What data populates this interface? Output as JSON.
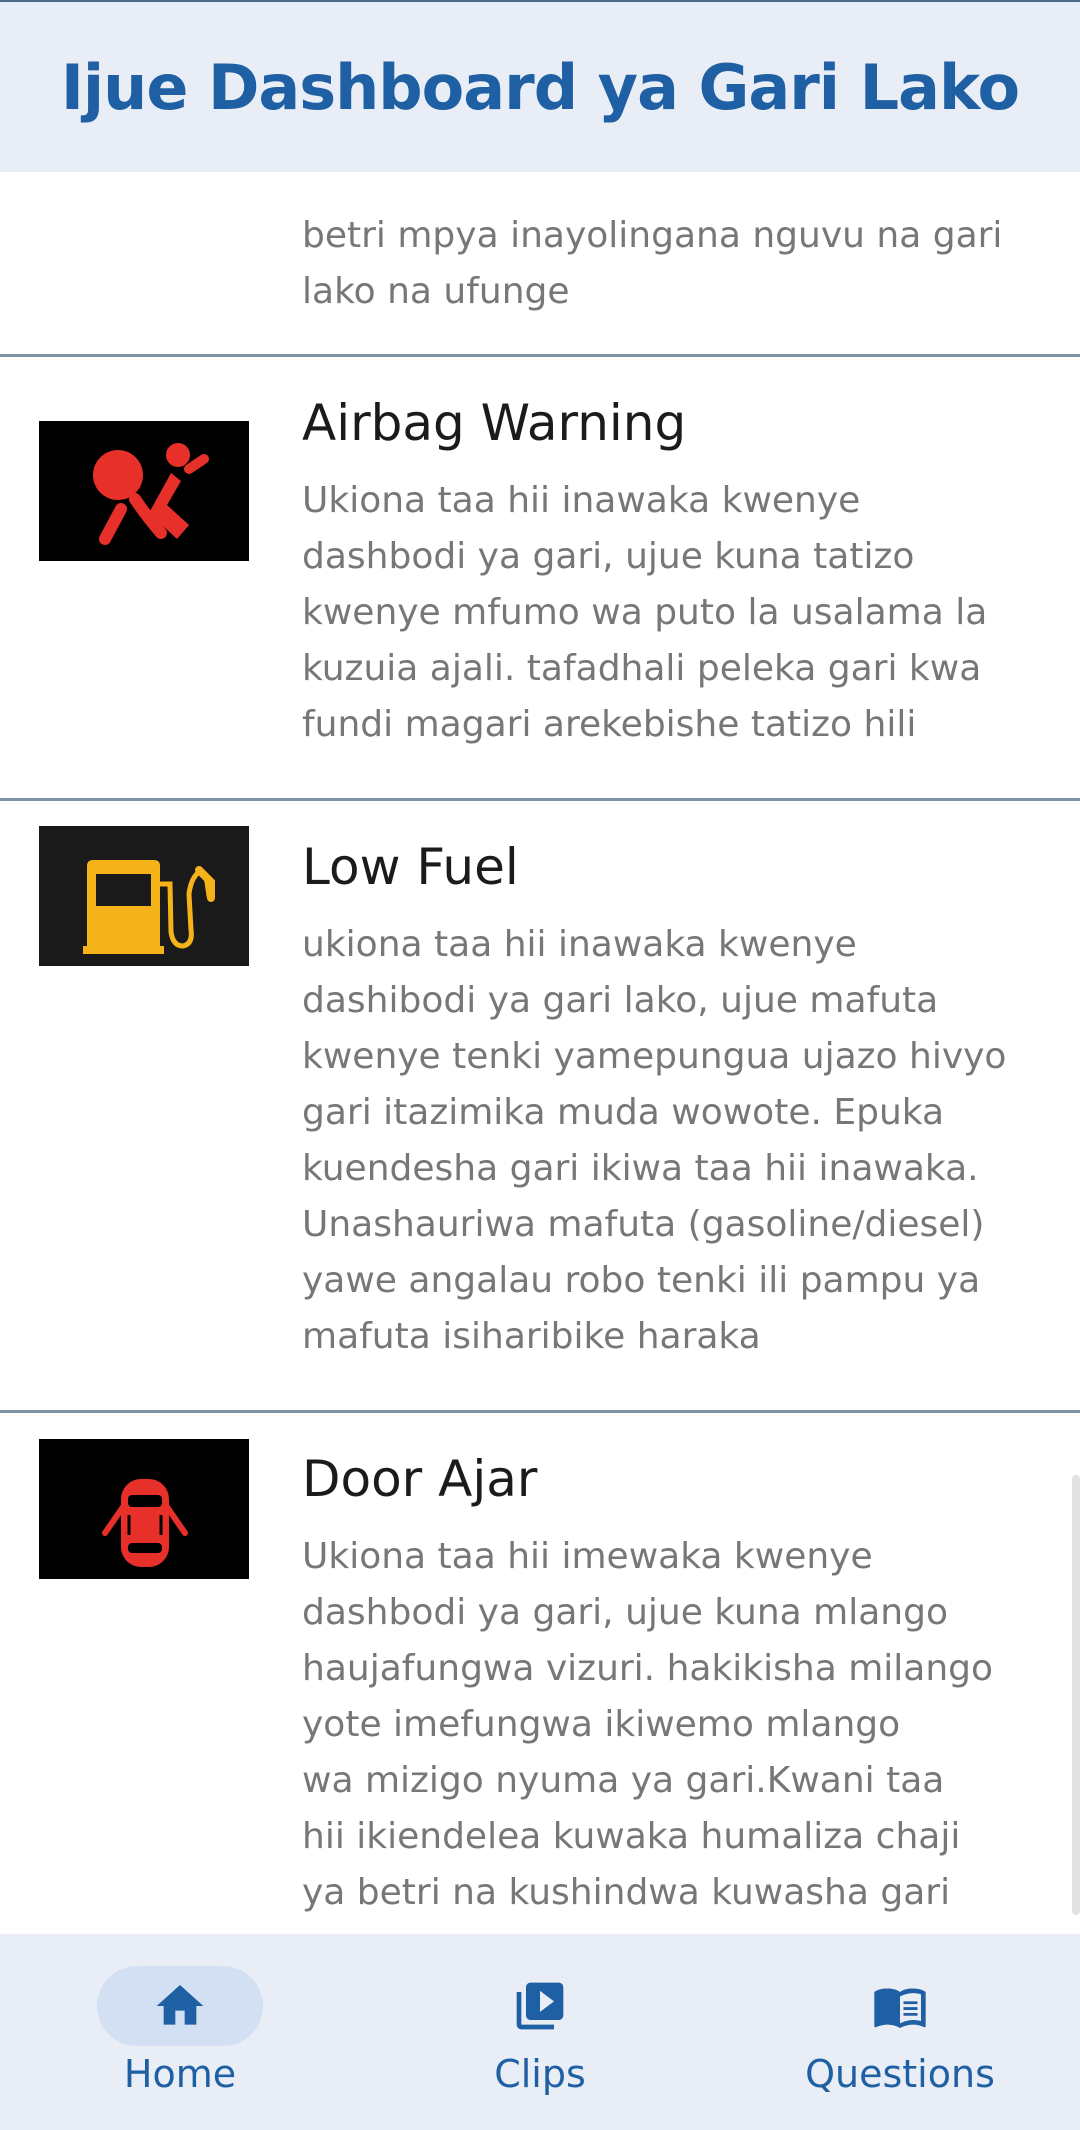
{
  "header": {
    "title": "Ijue Dashboard ya Gari Lako"
  },
  "partial_item": {
    "description": "betri mpya inayolingana nguvu na gari\nlako na ufunge"
  },
  "items": [
    {
      "title": "Airbag Warning",
      "icon": "airbag-warning-icon",
      "icon_color": "#e8302a",
      "description": "Ukiona taa hii inawaka kwenye\ndashbodi ya gari, ujue kuna tatizo\nkwenye mfumo wa puto la usalama la\nkuzuia ajali. tafadhali peleka gari kwa\nfundi magari arekebishe tatizo hili"
    },
    {
      "title": "Low Fuel",
      "icon": "fuel-pump-icon",
      "icon_color": "#f5b319",
      "description": "ukiona taa hii inawaka kwenye\ndashibodi ya gari lako, ujue mafuta\nkwenye tenki yamepungua ujazo hivyo\ngari itazimika muda wowote. Epuka\nkuendesha gari ikiwa taa hii inawaka.\nUnashauriwa mafuta (gasoline/diesel)\nyawe angalau robo tenki ili pampu ya\nmafuta isiharibike haraka"
    },
    {
      "title": "Door Ajar",
      "icon": "door-ajar-icon",
      "icon_color": "#e8302a",
      "description": "Ukiona taa hii imewaka kwenye\ndashbodi ya gari, ujue kuna mlango\nhaujafungwa vizuri. hakikisha milango\nyote imefungwa ikiwemo mlango\nwa mizigo nyuma ya gari.Kwani taa\nhii ikiendelea kuwaka humaliza chaji\nya betri na kushindwa kuwasha gari"
    }
  ],
  "nav": {
    "items": [
      {
        "label": "Home",
        "icon": "home-icon",
        "active": true
      },
      {
        "label": "Clips",
        "icon": "video-library-icon",
        "active": false
      },
      {
        "label": "Questions",
        "icon": "book-icon",
        "active": false
      }
    ],
    "accent": "#1f5fa3"
  }
}
